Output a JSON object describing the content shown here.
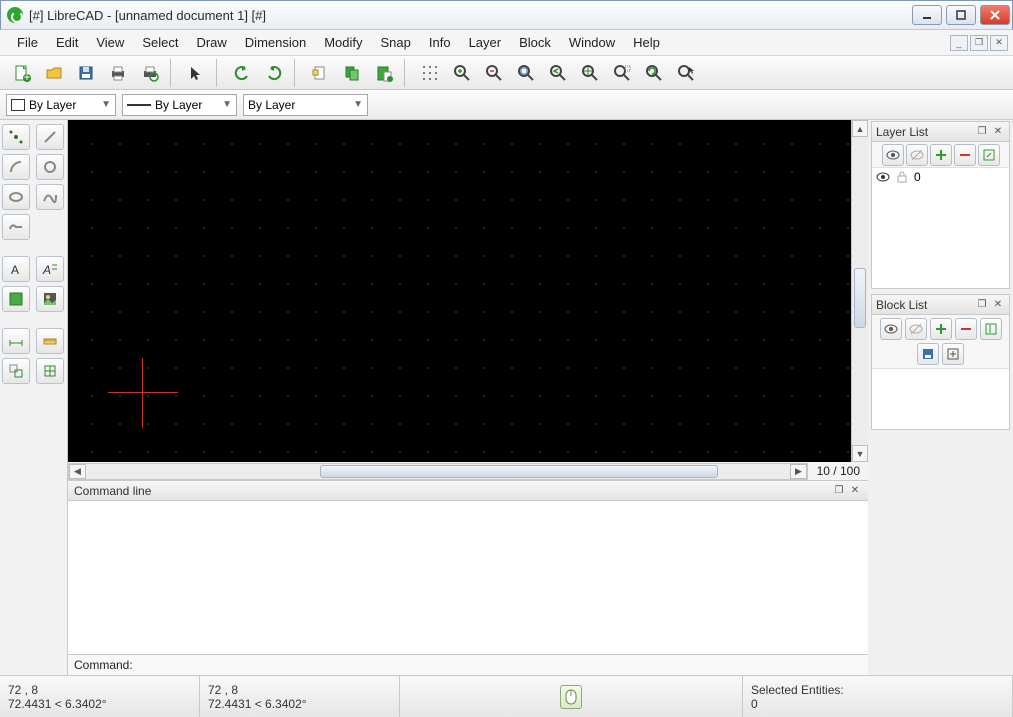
{
  "title": "[#] LibreCAD - [unnamed document 1] [#]",
  "menus": [
    "File",
    "Edit",
    "View",
    "Select",
    "Draw",
    "Dimension",
    "Modify",
    "Snap",
    "Info",
    "Layer",
    "Block",
    "Window",
    "Help"
  ],
  "combos": {
    "color": "By Layer",
    "width": "By Layer",
    "linetype": "By Layer"
  },
  "layer_panel": {
    "title": "Layer List",
    "rows": [
      {
        "name": "0"
      }
    ]
  },
  "block_panel": {
    "title": "Block List"
  },
  "command_panel": {
    "title": "Command line",
    "prompt": "Command:"
  },
  "zoom": "10 / 100",
  "status": {
    "abs1": "72 , 8",
    "polar1": "72.4431 < 6.3402°",
    "abs2": "72 , 8",
    "polar2": "72.4431 < 6.3402°",
    "sel_label": "Selected Entities:",
    "sel_count": "0"
  },
  "toolbar_icons": [
    "new",
    "open",
    "save",
    "print",
    "print-preview",
    "|",
    "pointer",
    "|",
    "undo",
    "redo",
    "|",
    "cut",
    "copy",
    "paste",
    "|",
    "grid",
    "zoom-in",
    "zoom-out",
    "zoom-auto",
    "zoom-prev",
    "zoom-pan",
    "zoom-window",
    "zoom-redraw",
    "zoom-select"
  ],
  "left_tools": [
    "point",
    "line",
    "rect",
    "circle",
    "ellipse",
    "spline",
    "arc",
    "",
    "text",
    "mtext",
    "hatch",
    "image",
    "",
    "dim",
    "measure",
    "poly",
    "explode"
  ]
}
